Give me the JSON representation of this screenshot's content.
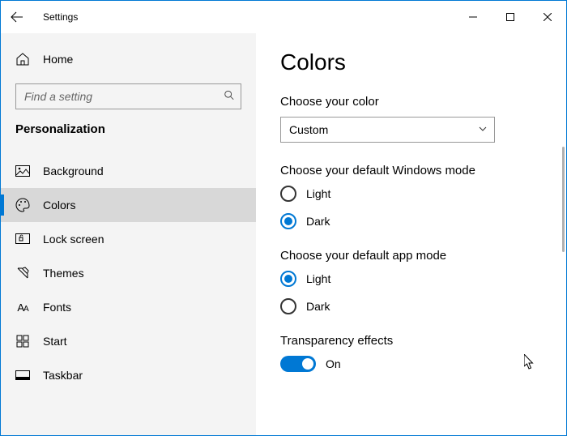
{
  "window": {
    "title": "Settings"
  },
  "sidebar": {
    "home_label": "Home",
    "search_placeholder": "Find a setting",
    "section": "Personalization",
    "items": [
      {
        "label": "Background"
      },
      {
        "label": "Colors"
      },
      {
        "label": "Lock screen"
      },
      {
        "label": "Themes"
      },
      {
        "label": "Fonts"
      },
      {
        "label": "Start"
      },
      {
        "label": "Taskbar"
      }
    ]
  },
  "main": {
    "title": "Colors",
    "choose_color_label": "Choose your color",
    "choose_color_value": "Custom",
    "windows_mode_label": "Choose your default Windows mode",
    "windows_mode_options": {
      "light": "Light",
      "dark": "Dark"
    },
    "windows_mode_selected": "dark",
    "app_mode_label": "Choose your default app mode",
    "app_mode_options": {
      "light": "Light",
      "dark": "Dark"
    },
    "app_mode_selected": "light",
    "transparency_label": "Transparency effects",
    "transparency_state": "On"
  },
  "colors": {
    "accent": "#0078d4"
  }
}
